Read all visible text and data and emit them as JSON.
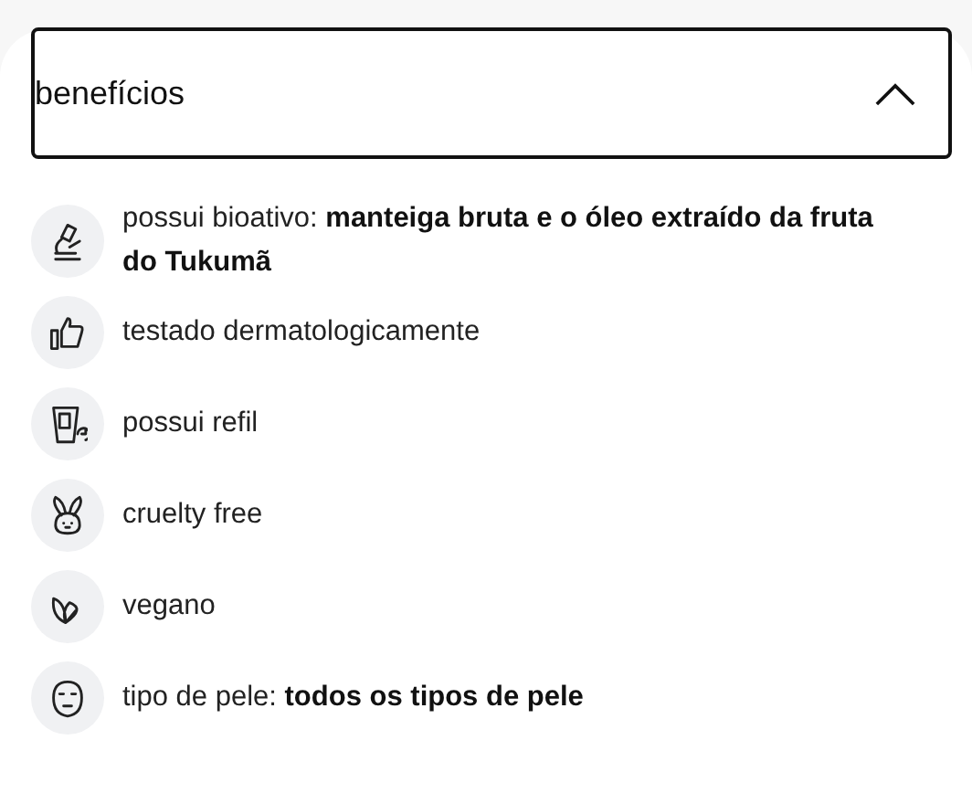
{
  "accordion": {
    "title": "benefícios",
    "expanded": true,
    "items": [
      {
        "kind": "microscope",
        "text": "possui bioativo: **manteiga bruta e o óleo extraído da fruta do Tukumã**"
      },
      {
        "kind": "thumb",
        "text": "testado dermatologicamente"
      },
      {
        "kind": "refill",
        "text": "possui refil"
      },
      {
        "kind": "rabbit",
        "text": "cruelty free"
      },
      {
        "kind": "leaves",
        "text": "vegano"
      },
      {
        "kind": "face",
        "text": "tipo de pele: **todos os tipos de pele**"
      }
    ]
  }
}
